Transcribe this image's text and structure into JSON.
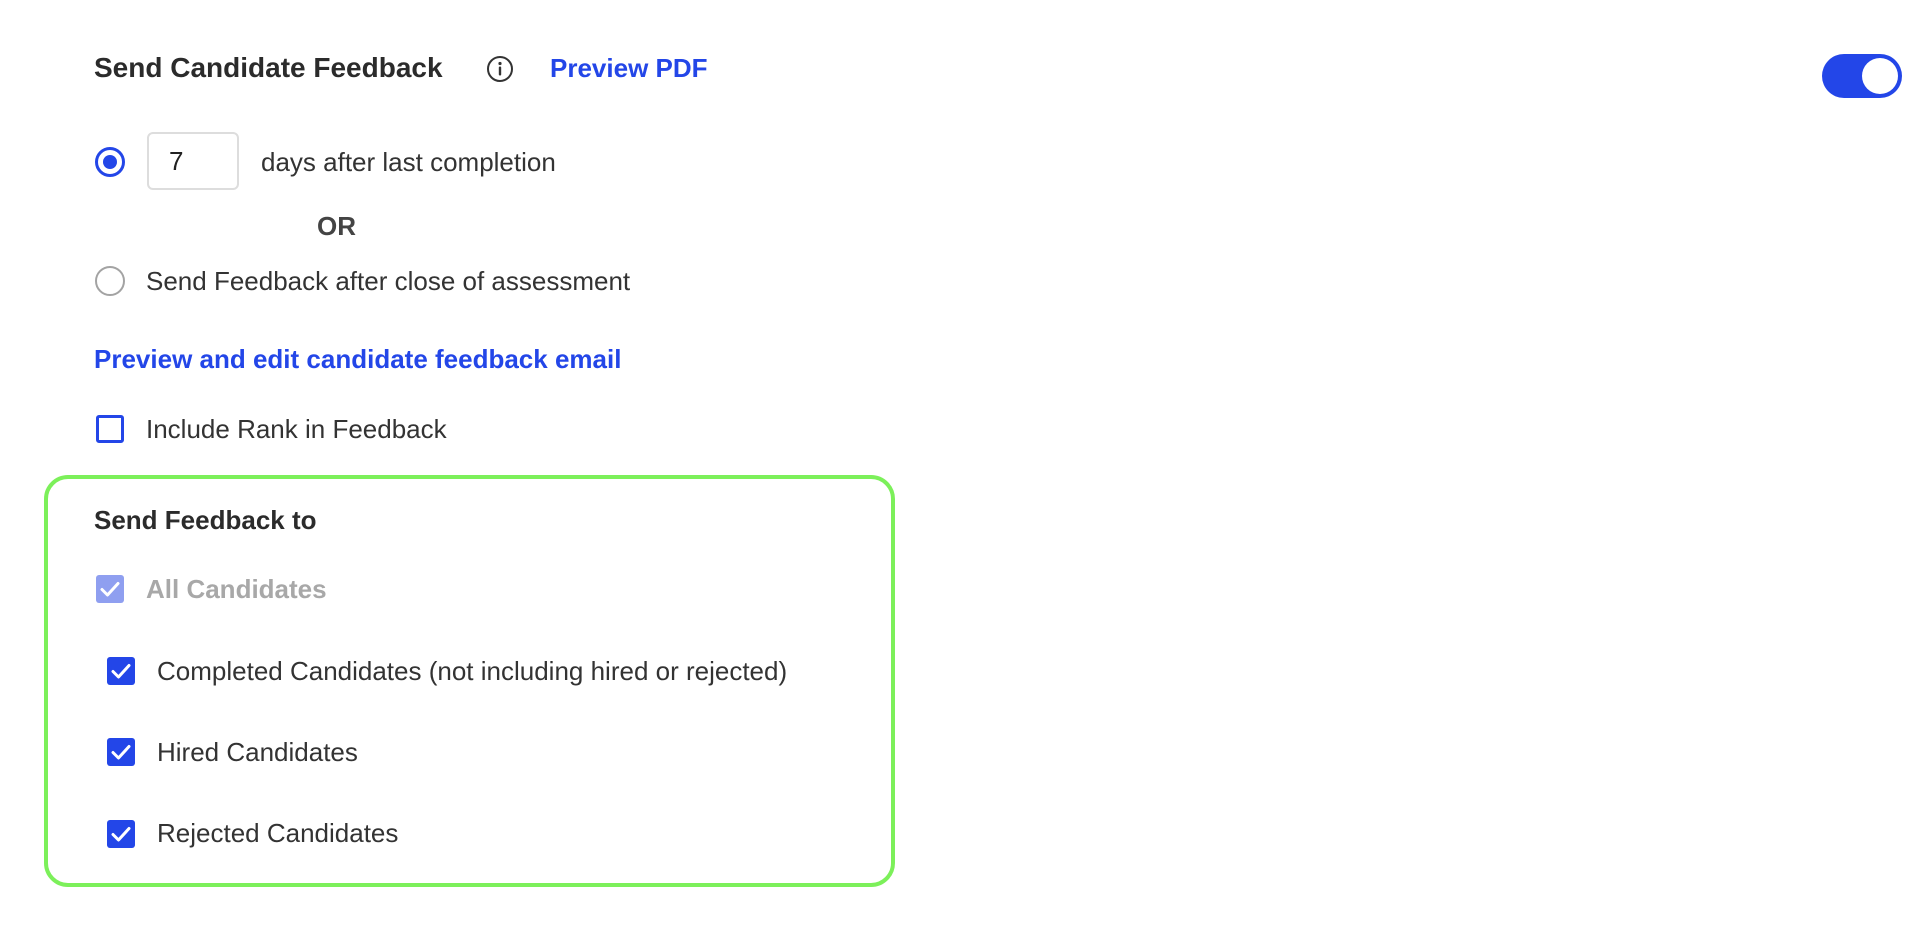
{
  "header": {
    "title": "Send Candidate Feedback",
    "info_icon": "info-icon",
    "preview_pdf_label": "Preview PDF",
    "toggle_enabled": true
  },
  "schedule": {
    "option_days": {
      "selected": true,
      "days_value": "7",
      "label": "days after last completion"
    },
    "or_label": "OR",
    "option_close": {
      "selected": false,
      "label": "Send Feedback after close of assessment"
    }
  },
  "email_link_label": "Preview and edit candidate feedback email",
  "include_rank": {
    "checked": false,
    "label": "Include Rank in Feedback"
  },
  "send_to": {
    "title": "Send Feedback to",
    "all": {
      "checked": true,
      "disabled": true,
      "label": "All Candidates"
    },
    "completed": {
      "checked": true,
      "label": "Completed Candidates (not including hired or rejected)"
    },
    "hired": {
      "checked": true,
      "label": "Hired Candidates"
    },
    "rejected": {
      "checked": true,
      "label": "Rejected Candidates"
    }
  },
  "colors": {
    "accent": "#2346e8",
    "highlight_border": "#7cf05a",
    "disabled_check": "#8f9ff0"
  }
}
